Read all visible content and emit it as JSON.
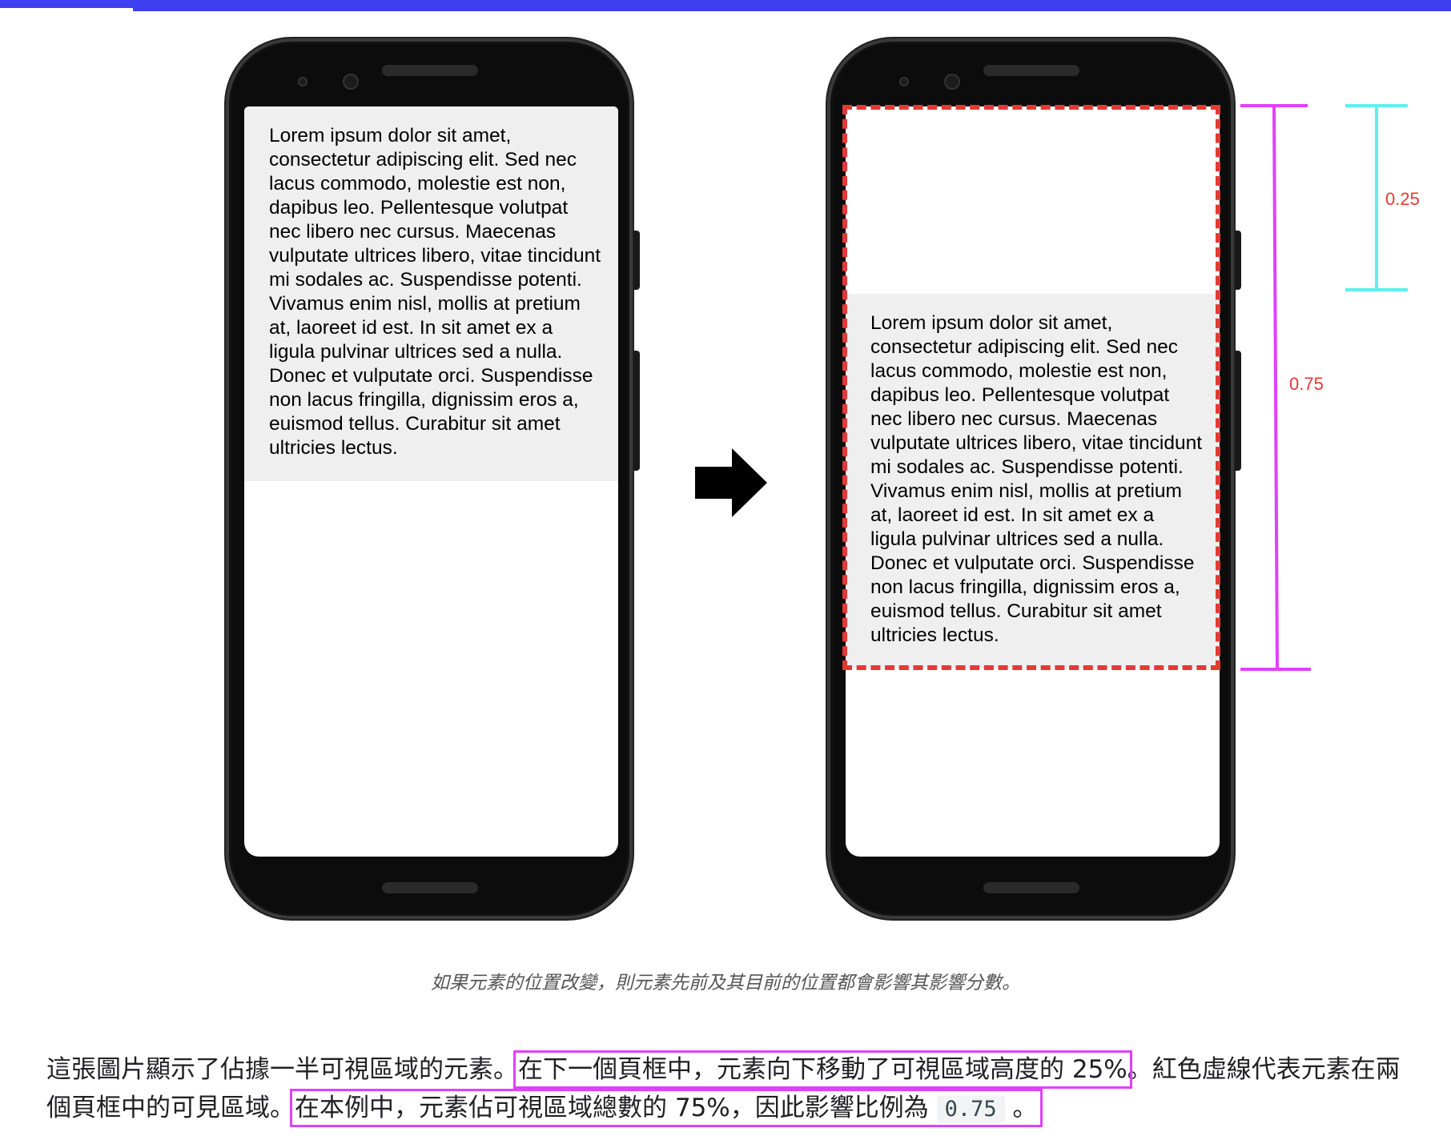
{
  "figure": {
    "lorem_text": "Lorem ipsum dolor sit amet, consectetur adipiscing elit. Sed nec lacus commodo, molestie est non, dapibus leo. Pellentesque volutpat nec libero nec cursus. Maecenas vulputate ultrices libero, vitae tincidunt mi sodales ac. Suspendisse potenti. Vivamus enim nisl, mollis at pretium at, laoreet id est. In sit amet ex a ligula pulvinar ultrices sed a nulla. Donec et vulputate orci. Suspendisse non lacus fringilla, dignissim eros a, euismod tellus. Curabitur sit amet ultricies lectus.",
    "move_fraction_label": "0.25",
    "impact_fraction_label": "0.75",
    "caption": "如果元素的位置改變，則元素先前及其目前的位置都會影響其影響分數。"
  },
  "paragraph": {
    "part1": "這張圖片顯示了佔據一半可視區域的元素。",
    "highlight1": "在下一個頁框中，元素向下移動了可視區域高度的 25%",
    "part2": "。紅色虛線代表元素在兩個頁框中的可見區域。",
    "highlight2_text": "在本例中，元素佔可視區域總數的 75%，因此影響比例為 ",
    "code": "0.75",
    "highlight2_end": " 。"
  },
  "colors": {
    "top_bar": "#3f3ff2",
    "dashed_outline": "#e53935",
    "measure_magenta": "#e040fb",
    "measure_cyan": "#5ef0f0",
    "label_red": "#e53935"
  },
  "icons": {
    "arrow": "right-arrow-icon"
  }
}
